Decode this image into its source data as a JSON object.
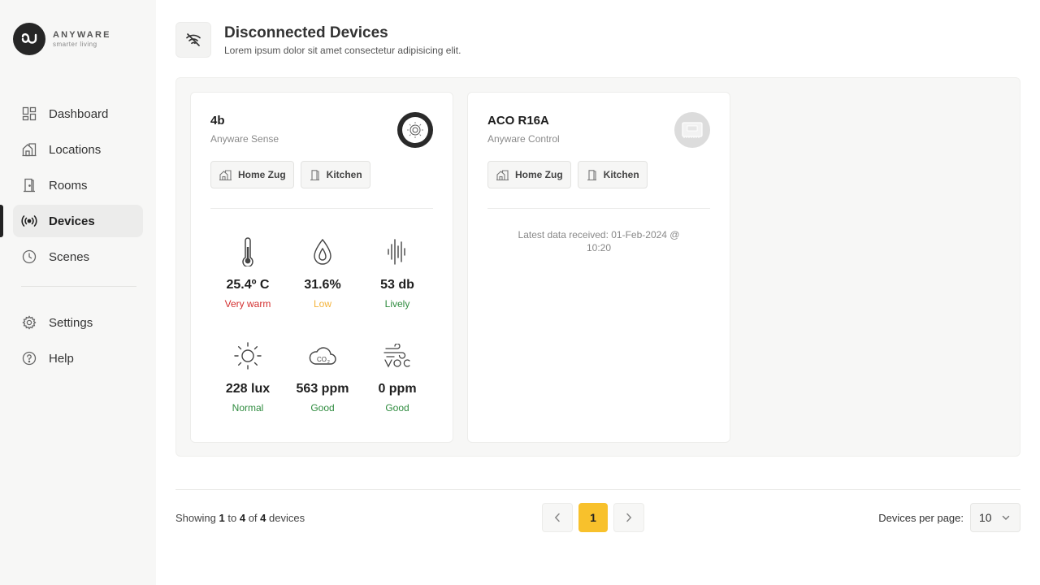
{
  "brand": {
    "name": "ANYWARE",
    "tagline": "smarter living"
  },
  "nav": {
    "items": [
      {
        "label": "Dashboard",
        "icon": "dashboard-icon"
      },
      {
        "label": "Locations",
        "icon": "locations-icon"
      },
      {
        "label": "Rooms",
        "icon": "rooms-icon"
      },
      {
        "label": "Devices",
        "icon": "devices-icon",
        "active": true
      },
      {
        "label": "Scenes",
        "icon": "scenes-icon"
      }
    ],
    "bottom": [
      {
        "label": "Settings",
        "icon": "gear-icon"
      },
      {
        "label": "Help",
        "icon": "help-icon"
      }
    ]
  },
  "header": {
    "title": "Disconnected Devices",
    "subtitle": "Lorem ipsum dolor sit amet consectetur adipisicing elit.",
    "icon": "wifi-off-icon"
  },
  "devices": [
    {
      "name": "4b",
      "type": "Anyware Sense",
      "location": "Home Zug",
      "room": "Kitchen",
      "metrics": [
        {
          "icon": "thermometer-icon",
          "value": "25.4º C",
          "status": "Very warm",
          "color": "#d32f2f"
        },
        {
          "icon": "humidity-icon",
          "value": "31.6%",
          "status": "Low",
          "color": "#f4b33a"
        },
        {
          "icon": "sound-icon",
          "value": "53 db",
          "status": "Lively",
          "color": "#2e8b3e"
        },
        {
          "icon": "sun-icon",
          "value": "228 lux",
          "status": "Normal",
          "color": "#2e8b3e"
        },
        {
          "icon": "co2-cloud-icon",
          "value": "563 ppm",
          "status": "Good",
          "color": "#2e8b3e"
        },
        {
          "icon": "voc-icon",
          "value": "0 ppm",
          "status": "Good",
          "color": "#2e8b3e"
        }
      ]
    },
    {
      "name": "ACO R16A",
      "type": "Anyware Control",
      "location": "Home Zug",
      "room": "Kitchen",
      "last_data": "Latest data received: 01-Feb-2024 @ 10:20"
    }
  ],
  "footer": {
    "showing_prefix": "Showing",
    "from": "1",
    "to_word": "to",
    "to": "4",
    "of_word": "of",
    "total": "4",
    "suffix": "devices",
    "current_page": "1",
    "per_page_label": "Devices per page:",
    "per_page_value": "10"
  },
  "colors": {
    "accent": "#f8c12c",
    "danger": "#d32f2f",
    "warning": "#f4b33a",
    "ok": "#2e8b3e"
  }
}
